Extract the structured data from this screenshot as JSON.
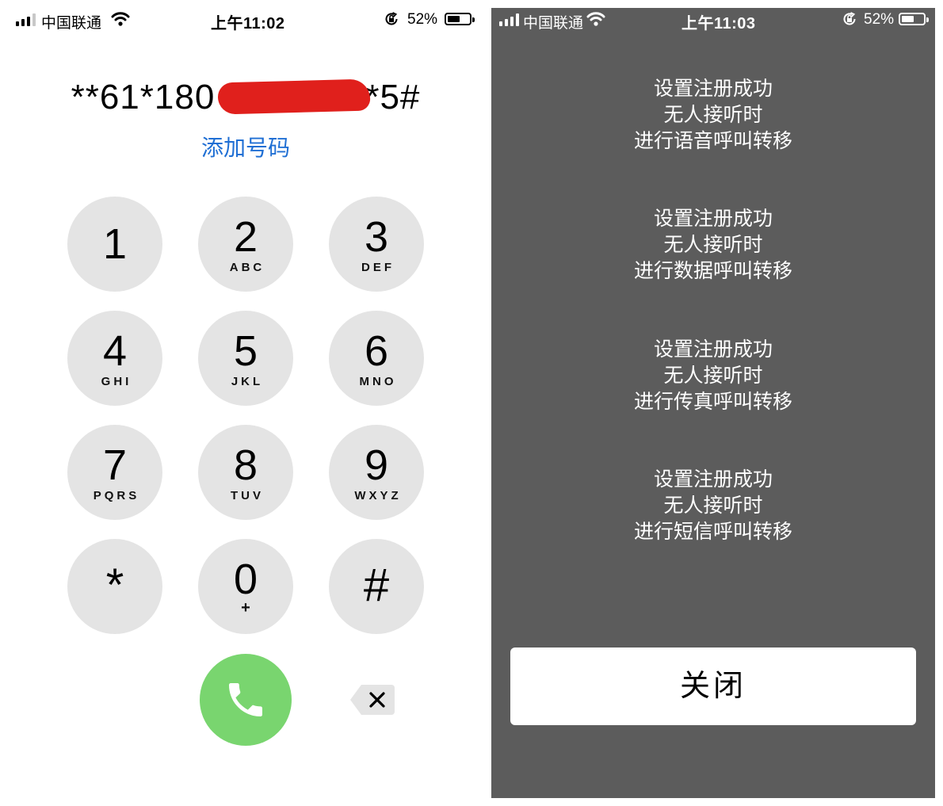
{
  "left": {
    "status": {
      "carrier": "中国联通",
      "time": "上午11:02",
      "battery": "52%"
    },
    "dialed": {
      "prefix": "**61*180",
      "suffix": "*5#"
    },
    "add_number": "添加号码",
    "keys": [
      {
        "digit": "1",
        "letters": ""
      },
      {
        "digit": "2",
        "letters": "ABC"
      },
      {
        "digit": "3",
        "letters": "DEF"
      },
      {
        "digit": "4",
        "letters": "GHI"
      },
      {
        "digit": "5",
        "letters": "JKL"
      },
      {
        "digit": "6",
        "letters": "MNO"
      },
      {
        "digit": "7",
        "letters": "PQRS"
      },
      {
        "digit": "8",
        "letters": "TUV"
      },
      {
        "digit": "9",
        "letters": "WXYZ"
      },
      {
        "digit": "*",
        "letters": ""
      },
      {
        "digit": "0",
        "letters": "+"
      },
      {
        "digit": "#",
        "letters": ""
      }
    ],
    "call_icon": "phone-icon",
    "delete_icon": "backspace-icon",
    "call_color": "#79d56f",
    "link_color": "#1f6fd4"
  },
  "right": {
    "status": {
      "carrier": "中国联通",
      "time": "上午11:03",
      "battery": "52%"
    },
    "messages": [
      {
        "line1": "设置注册成功",
        "line2": "无人接听时",
        "line3": "进行语音呼叫转移"
      },
      {
        "line1": "设置注册成功",
        "line2": "无人接听时",
        "line3": "进行数据呼叫转移"
      },
      {
        "line1": "设置注册成功",
        "line2": "无人接听时",
        "line3": "进行传真呼叫转移"
      },
      {
        "line1": "设置注册成功",
        "line2": "无人接听时",
        "line3": "进行短信呼叫转移"
      }
    ],
    "close_label": "关闭",
    "background": "#5c5c5c"
  }
}
